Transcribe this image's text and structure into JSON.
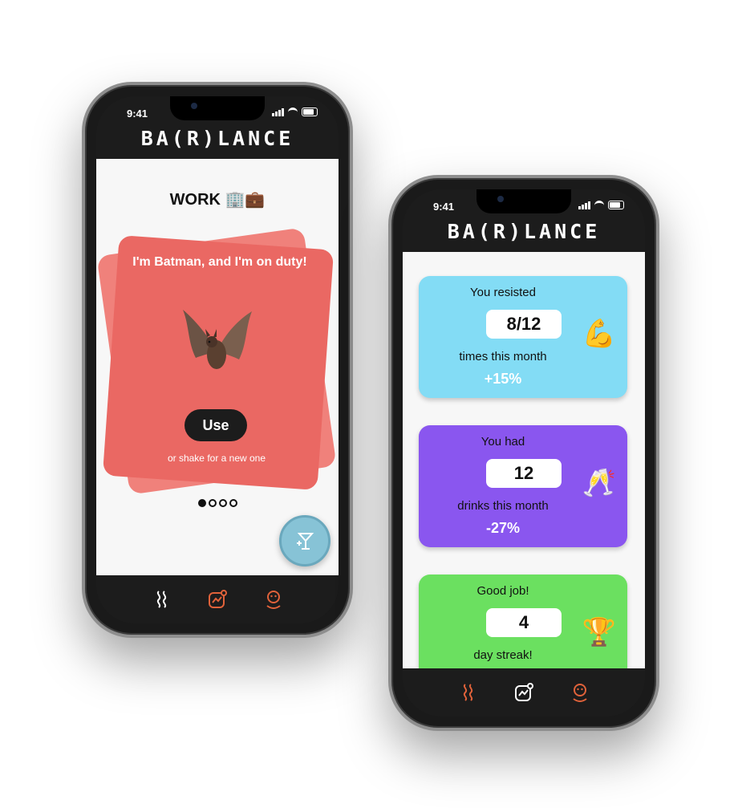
{
  "app": {
    "logo": "BA(R)LANCE",
    "status_time": "9:41"
  },
  "left_phone": {
    "section_title": "WORK 🏢💼",
    "card": {
      "text": "I'm Batman, and I'm on duty!",
      "use_label": "Use",
      "hint": "or shake for a new one"
    },
    "pagination": {
      "total": 4,
      "active": 1
    }
  },
  "right_phone": {
    "stats": [
      {
        "top": "You resisted",
        "value": "8/12",
        "unit": "times this month",
        "change": "+15%",
        "emoji": "💪",
        "color": "#83dcf5"
      },
      {
        "top": "You had",
        "value": "12",
        "unit": "drinks this month",
        "change": "-27%",
        "emoji": "🥂",
        "color": "#8a56ef"
      },
      {
        "top": "Good job!",
        "value": "4",
        "unit": "day streak!",
        "change": "",
        "emoji": "🏆",
        "color": "#6be060"
      }
    ]
  },
  "nav": {
    "items": [
      "waves-icon",
      "chart-icon",
      "profile-icon"
    ]
  },
  "colors": {
    "accent": "#e0623a",
    "dark": "#1c1c1c",
    "card_red": "#ea6863"
  }
}
